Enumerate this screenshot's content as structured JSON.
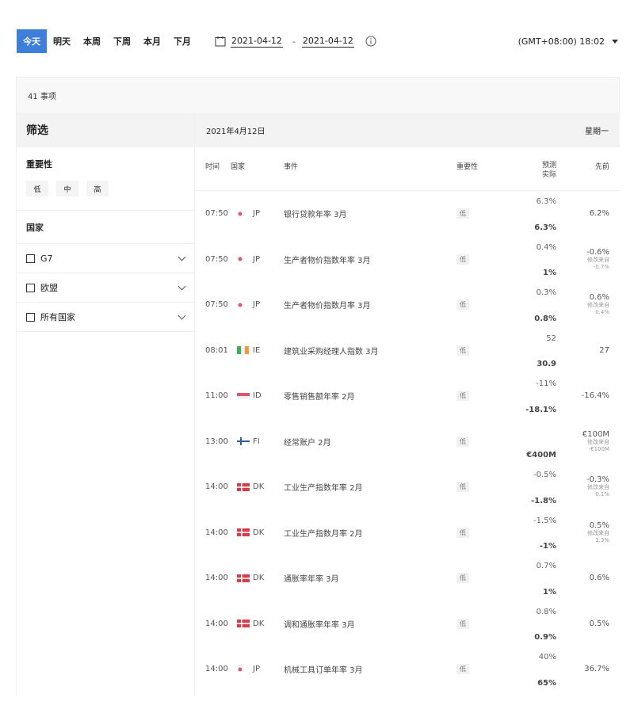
{
  "toolbar": {
    "tabs": [
      "今天",
      "明天",
      "本周",
      "下周",
      "本月",
      "下月"
    ],
    "active_tab": "今天",
    "date_from": "2021-04-12",
    "date_sep": "-",
    "date_to": "2021-04-12",
    "timezone": "(GMT+08:00) 18:02"
  },
  "summary": {
    "count_label": "41 事项"
  },
  "sidebar": {
    "title": "筛选",
    "importance_title": "重要性",
    "importance_levels": [
      "低",
      "中",
      "高"
    ],
    "country_title": "国家",
    "groups": [
      "G7",
      "欧盟",
      "所有国家"
    ]
  },
  "table": {
    "date": "2021年4月12日",
    "weekday": "星期一",
    "headers": {
      "time": "时间",
      "country": "国家",
      "event": "事件",
      "importance": "重要性",
      "forecast": "预测",
      "actual": "实际",
      "previous": "先前"
    },
    "revised_label": "修改来自",
    "rows": [
      {
        "time": "07:50",
        "country": "JP",
        "flag": "jp",
        "event": "银行贷款年率 3月",
        "importance": "低",
        "forecast": "6.3%",
        "actual": "6.3%",
        "previous": "6.2%",
        "revised": ""
      },
      {
        "time": "07:50",
        "country": "JP",
        "flag": "jp",
        "event": "生产者物价指数年率 3月",
        "importance": "低",
        "forecast": "0.4%",
        "actual": "1%",
        "previous": "-0.6%",
        "revised": "-0.7%"
      },
      {
        "time": "07:50",
        "country": "JP",
        "flag": "jp",
        "event": "生产者物价指数月率 3月",
        "importance": "低",
        "forecast": "0.3%",
        "actual": "0.8%",
        "previous": "0.6%",
        "revised": "0.4%"
      },
      {
        "time": "08:01",
        "country": "IE",
        "flag": "ie",
        "event": "建筑业采购经理人指数 3月",
        "importance": "低",
        "forecast": "52",
        "actual": "30.9",
        "previous": "27",
        "revised": ""
      },
      {
        "time": "11:00",
        "country": "ID",
        "flag": "id",
        "event": "零售销售额年率 2月",
        "importance": "低",
        "forecast": "-11%",
        "actual": "-18.1%",
        "previous": "-16.4%",
        "revised": ""
      },
      {
        "time": "13:00",
        "country": "FI",
        "flag": "fi",
        "event": "经常账户 2月",
        "importance": "低",
        "forecast": "",
        "actual": "€400M",
        "previous": "€100M",
        "revised": "-€100M"
      },
      {
        "time": "14:00",
        "country": "DK",
        "flag": "dk",
        "event": "工业生产指数年率 2月",
        "importance": "低",
        "forecast": "-0.5%",
        "actual": "-1.8%",
        "previous": "-0.3%",
        "revised": "0.1%"
      },
      {
        "time": "14:00",
        "country": "DK",
        "flag": "dk",
        "event": "工业生产指数月率 2月",
        "importance": "低",
        "forecast": "-1.5%",
        "actual": "-1%",
        "previous": "0.5%",
        "revised": "1.3%"
      },
      {
        "time": "14:00",
        "country": "DK",
        "flag": "dk",
        "event": "通胀率年率 3月",
        "importance": "低",
        "forecast": "0.7%",
        "actual": "1%",
        "previous": "0.6%",
        "revised": ""
      },
      {
        "time": "14:00",
        "country": "DK",
        "flag": "dk",
        "event": "调和通胀率年率 3月",
        "importance": "低",
        "forecast": "0.8%",
        "actual": "0.9%",
        "previous": "0.5%",
        "revised": ""
      },
      {
        "time": "14:00",
        "country": "JP",
        "flag": "jp",
        "event": "机械工具订单年率 3月",
        "importance": "低",
        "forecast": "40%",
        "actual": "65%",
        "previous": "36.7%",
        "revised": ""
      }
    ]
  },
  "colors": {
    "accent": "#3d7fd9",
    "header_bg": "#f3f3f3"
  }
}
